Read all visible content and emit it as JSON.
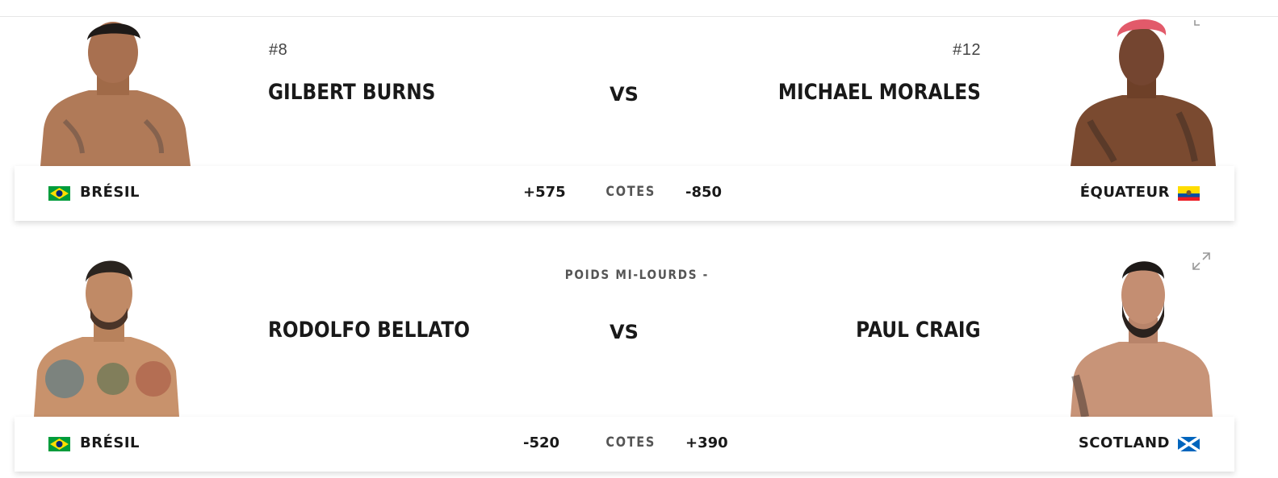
{
  "bouts": [
    {
      "weight_class": "",
      "red": {
        "rank": "#8",
        "name": "GILBERT BURNS",
        "country": "BRÉSIL",
        "flag": "brazil-flag",
        "odds": "+575"
      },
      "blue": {
        "rank": "#12",
        "name": "MICHAEL MORALES",
        "country": "ÉQUATEUR",
        "flag": "ecuador-flag",
        "odds": "-850"
      },
      "vs_label": "VS",
      "odds_label": "COTES"
    },
    {
      "weight_class": "POIDS MI-LOURDS -",
      "red": {
        "rank": "",
        "name": "RODOLFO BELLATO",
        "country": "BRÉSIL",
        "flag": "brazil-flag",
        "odds": "-520"
      },
      "blue": {
        "rank": "",
        "name": "PAUL CRAIG",
        "country": "SCOTLAND",
        "flag": "scotland-flag",
        "odds": "+390"
      },
      "vs_label": "VS",
      "odds_label": "COTES"
    }
  ],
  "colors": {
    "brazil_green": "#009c3b",
    "brazil_yellow": "#ffdf00",
    "brazil_blue": "#002776",
    "ecuador_yellow": "#ffdd00",
    "ecuador_blue": "#034ea2",
    "ecuador_red": "#ed1c24",
    "scotland_blue": "#0065bd"
  }
}
